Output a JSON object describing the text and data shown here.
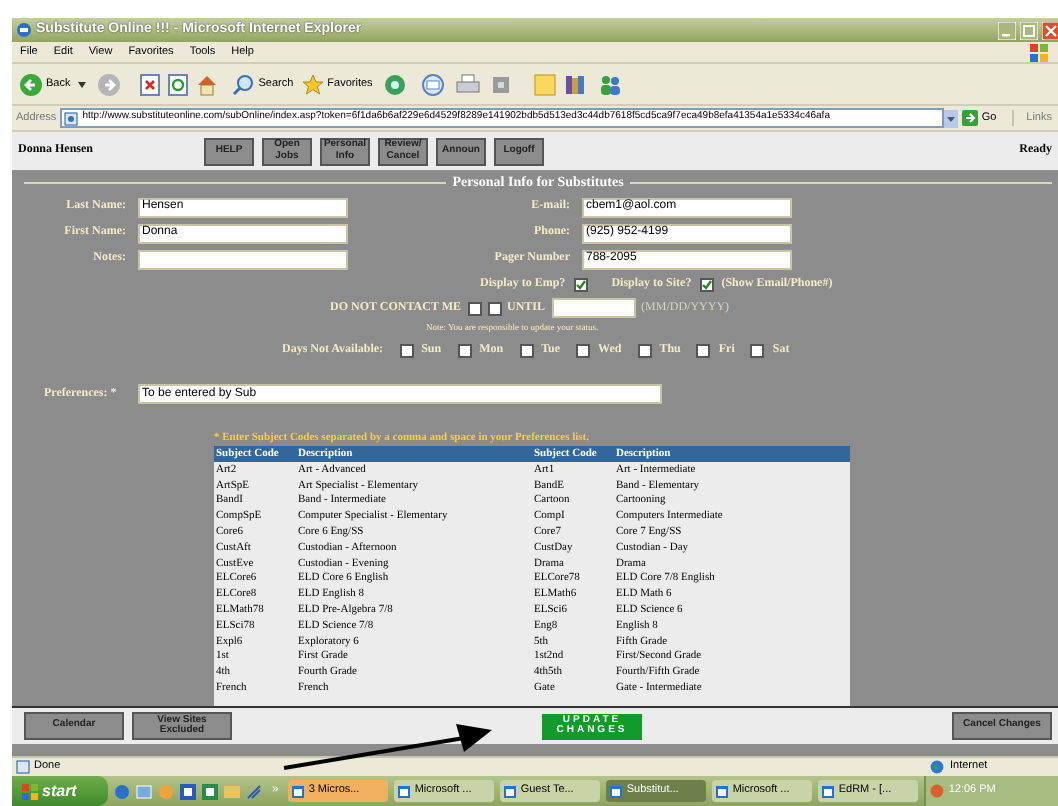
{
  "window": {
    "title": "Substitute Online !!! - Microsoft Internet Explorer"
  },
  "menu": [
    "File",
    "Edit",
    "View",
    "Favorites",
    "Tools",
    "Help"
  ],
  "toolbar": {
    "back": "Back",
    "search": "Search",
    "favorites": "Favorites"
  },
  "address_bar": {
    "label": "Address",
    "url": "http://www.substituteonline.com/subOnline/index.asp?token=6f1da6b6af229e6d4529f8289e141902bdb5d513ed3c44db7618f5cd5ca9f7eca49b8efa41354a1e5334c46afa",
    "go": "Go",
    "links": "Links"
  },
  "nav": {
    "user": "Donna Hensen",
    "buttons": [
      "HELP",
      "Open Jobs",
      "Personal Info",
      "Review/ Cancel",
      "Announ",
      "Logoff"
    ],
    "status": "Ready"
  },
  "form": {
    "title": "Personal Info for Substitutes",
    "rows": [
      {
        "left": {
          "label": "Last Name:",
          "value": "Hensen"
        },
        "right": {
          "label": "E-mail:",
          "value": "cbem1@aol.com"
        }
      },
      {
        "left": {
          "label": "First Name:",
          "value": "Donna"
        },
        "right": {
          "label": "Phone:",
          "value": "(925) 952-4199"
        }
      },
      {
        "left": {
          "label": "Notes:"
        },
        "right": {
          "label": "Pager Number",
          "value": "788-2095"
        }
      }
    ],
    "display": [
      {
        "label": "Display to Emp?",
        "checked": true
      },
      {
        "label": "Display to Site?",
        "checked": true
      }
    ],
    "display_note": "(Show Email/Phone#)",
    "do_not_contact": {
      "label": "DO NOT CONTACT ME",
      "checked": false,
      "until_label": "UNTIL",
      "until_checked": false,
      "date_hint": "(MM/DD/YYYY)"
    },
    "note": "Note: You are responsible to update your status.",
    "days_label": "Days Not Available:",
    "days": [
      {
        "label": "Sun",
        "checked": false
      },
      {
        "label": "Mon",
        "checked": false
      },
      {
        "label": "Tue",
        "checked": false
      },
      {
        "label": "Wed",
        "checked": false
      },
      {
        "label": "Thu",
        "checked": false
      },
      {
        "label": "Fri",
        "checked": false
      },
      {
        "label": "Sat",
        "checked": false
      }
    ],
    "preferences": {
      "label": "Preferences: *",
      "value": "To be entered by Sub"
    },
    "subject_note": "* Enter Subject Codes separated by a comma and space in your Preferences list.",
    "subject_table": {
      "columns": [
        "Subject Code",
        "Description",
        "Subject Code",
        "Description"
      ],
      "rows": [
        [
          "Art2",
          "Art - Advanced",
          "Art1",
          "Art - Intermediate"
        ],
        [
          "ArtSpE",
          "Art Specialist - Elementary",
          "BandE",
          "Band - Elementary"
        ],
        [
          "BandI",
          "Band - Intermediate",
          "Cartoon",
          "Cartooning"
        ],
        [
          "CompSpE",
          "Computer Specialist - Elementary",
          "CompI",
          "Computers Intermediate"
        ],
        [
          "Core6",
          "Core 6 Eng/SS",
          "Core7",
          "Core 7 Eng/SS"
        ],
        [
          "CustAft",
          "Custodian - Afternoon",
          "CustDay",
          "Custodian - Day"
        ],
        [
          "CustEve",
          "Custodian - Evening",
          "Drama",
          "Drama"
        ],
        [
          "ELCore6",
          "ELD Core 6 English",
          "ELCore78",
          "ELD Core 7/8 English"
        ],
        [
          "ELCore8",
          "ELD English 8",
          "ELMath6",
          "ELD Math 6"
        ],
        [
          "ELMath78",
          "ELD Pre-Algebra 7/8",
          "ELSci6",
          "ELD Science 6"
        ],
        [
          "ELSci78",
          "ELD Science 7/8",
          "Eng8",
          "English 8"
        ],
        [
          "Expl6",
          "Exploratory 6",
          "5th",
          "Fifth Grade"
        ],
        [
          "1st",
          "First Grade",
          "1st2nd",
          "First/Second Grade"
        ],
        [
          "4th",
          "Fourth Grade",
          "4th5th",
          "Fourth/Fifth Grade"
        ],
        [
          "French",
          "French",
          "Gate",
          "Gate - Intermediate"
        ]
      ]
    }
  },
  "actions": [
    {
      "kind": "plain",
      "label": "Calendar"
    },
    {
      "kind": "plain",
      "label": "View Sites Excluded"
    },
    {
      "kind": "update",
      "label": "UPDATE CHANGES"
    },
    {
      "kind": "plain",
      "label": "Cancel Changes"
    }
  ],
  "status_bar": {
    "text": "Done",
    "zone": "Internet"
  },
  "taskbar": {
    "start": "start",
    "more": "»",
    "tasks": [
      {
        "label": "3 Micros...",
        "selected": false,
        "kind": "group"
      },
      {
        "label": "Microsoft ...",
        "selected": false
      },
      {
        "label": "Guest Te...",
        "selected": false
      },
      {
        "label": "Substitut...",
        "selected": true
      },
      {
        "label": "Microsoft ...",
        "selected": false
      },
      {
        "label": "EdRM - [...",
        "selected": false
      }
    ],
    "clock": "12:06 PM"
  }
}
